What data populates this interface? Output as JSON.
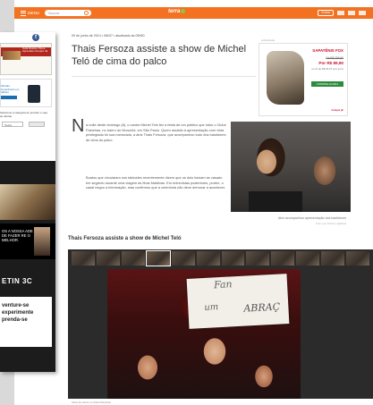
{
  "topbar": {
    "menu_label": "MENU",
    "search_placeholder": "Buscar",
    "logo": "terra",
    "login_label": "Entrar"
  },
  "article": {
    "date": "09 de junho de 2014 • 08h37 • atualizado às 09h50",
    "title": "Thais Fersoza assiste a show de Michel Teló de cima do palco",
    "dropcap": "N",
    "paragraph1": "a noite deste domingo (8), o cantor Michel Teló fez a festa de um público que lotou o Clube Paineiras, no bairro do Morumbi, em São Paulo. Quem assistiu à apresentação com vista privilegiada foi sua namorada, a atriz Thais Fersoza, que acompanhou tudo dos bastidores de cima do palco.",
    "paragraph2": "Boatos que circularam nos tabloides recentemente dizem que os dois haviam se casado em segredo durante uma viagem às Ilhas Maldivas. Em entrevistas posteriores, porém, o casal negou a informação, mas confirmou que a cerimônia não deve demorar a acontecer.",
    "photo_caption": "Atriz acompanhou apresentação dos bastidores",
    "photo_credit": "Foto: Leo Franco / AgNews"
  },
  "ad": {
    "label": "publicidade",
    "brand": "SAPATÊNIS FOX",
    "old_price": "De R$ 259,90",
    "new_price": "Por R$ 89,90",
    "installments": "ou 3x de R$ 29,97 sem juros",
    "buy_label": "COMPRE AGORA",
    "footer": "Compre já!"
  },
  "gallery": {
    "title": "Thais Fersoza assiste a show de Michel Teló",
    "sign_words": [
      "Fan",
      "um",
      "ABRAÇ"
    ],
    "caption": "Show do cantor no Clube Paineiras"
  },
  "side_panel": {
    "fb": "f",
    "promo_text": "Sofá Rústico Pinus Aproveite Compre Já",
    "device_text": "Ofertas imperdíveis em tablets",
    "form_label": "Selecione a categoria do produto e veja as ofertas",
    "select_value": "Todos",
    "dark_text": "OS A NOSSA ADE DE FAZER RE O MELHOR.",
    "logo_text": "ETIN 3C",
    "white_text": "venture-se experimente prenda-se"
  },
  "colors": {
    "brand_orange": "#f37221",
    "ad_red": "#c8102e",
    "buy_green": "#2e8b3d"
  }
}
